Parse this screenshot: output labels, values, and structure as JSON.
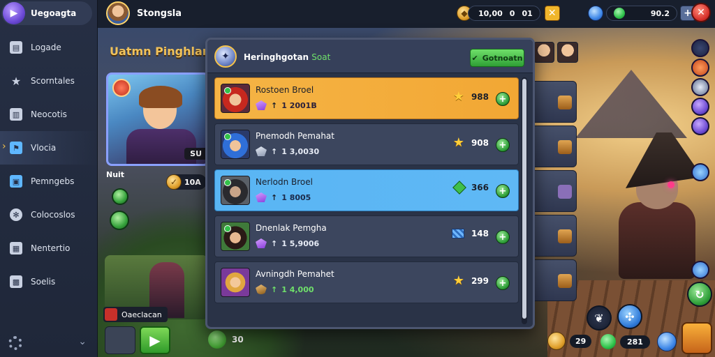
{
  "brand": {
    "name": "Uegoagta",
    "logo_icon": "play-icon"
  },
  "player": {
    "name": "Stongsla"
  },
  "resources": {
    "coins": {
      "value": "10,00",
      "extra_a": "0",
      "extra_b": "01"
    },
    "gems": {
      "value": "90.2"
    }
  },
  "sidebar": {
    "items": [
      {
        "label": "Logade",
        "icon": "map-icon"
      },
      {
        "label": "Scorntales",
        "icon": "star-icon"
      },
      {
        "label": "Neocotis",
        "icon": "chart-icon"
      },
      {
        "label": "Vlocia",
        "icon": "flag-icon",
        "active": true
      },
      {
        "label": "Pemngebs",
        "icon": "chat-icon"
      },
      {
        "label": "Colocoslos",
        "icon": "gear-icon"
      },
      {
        "label": "Nentertio",
        "icon": "shop-icon"
      },
      {
        "label": "Soelis",
        "icon": "grid-icon"
      }
    ]
  },
  "background": {
    "title": "Uatmn Pinghlar Pea",
    "hero_level": "SU",
    "hero_caption": "Nuit",
    "coin_value": "10A",
    "name_tag": "Oaeclacan",
    "leaf_count": "30"
  },
  "modal": {
    "title": "Heringhgotan",
    "title_accent": "Soat",
    "cta_label": "Gotnoatn",
    "rows": [
      {
        "name": "Rostoen Broel",
        "sub": "1 2001B",
        "score": "988",
        "style": "gold",
        "score_icon": "star",
        "gem": "purple",
        "arrow": "dark"
      },
      {
        "name": "Pnemodh Pemahat",
        "sub": "1 3,0030",
        "score": "908",
        "style": "plain",
        "score_icon": "star",
        "gem": "silver",
        "arrow": "light"
      },
      {
        "name": "Nerlodn Broel",
        "sub": "1 8005",
        "score": "366",
        "style": "blue",
        "score_icon": "diamond",
        "gem": "purple",
        "arrow": "dark"
      },
      {
        "name": "Dnenlak Pemgha",
        "sub": "1 5,9006",
        "score": "148",
        "style": "plain",
        "score_icon": "flag",
        "gem": "purple",
        "arrow": "light"
      },
      {
        "name": "Avningdh Pemahet",
        "sub": "1 4,000",
        "score": "299",
        "style": "plain",
        "score_icon": "star",
        "gem": "leaf",
        "arrow": "green"
      }
    ]
  },
  "bottom_right": {
    "coin_count": "29",
    "gem_count": "281"
  },
  "colors": {
    "accent_gold": "#f5b445",
    "accent_blue": "#59b5f4",
    "accent_green": "#2f9f35",
    "panel": "#2a3347"
  }
}
